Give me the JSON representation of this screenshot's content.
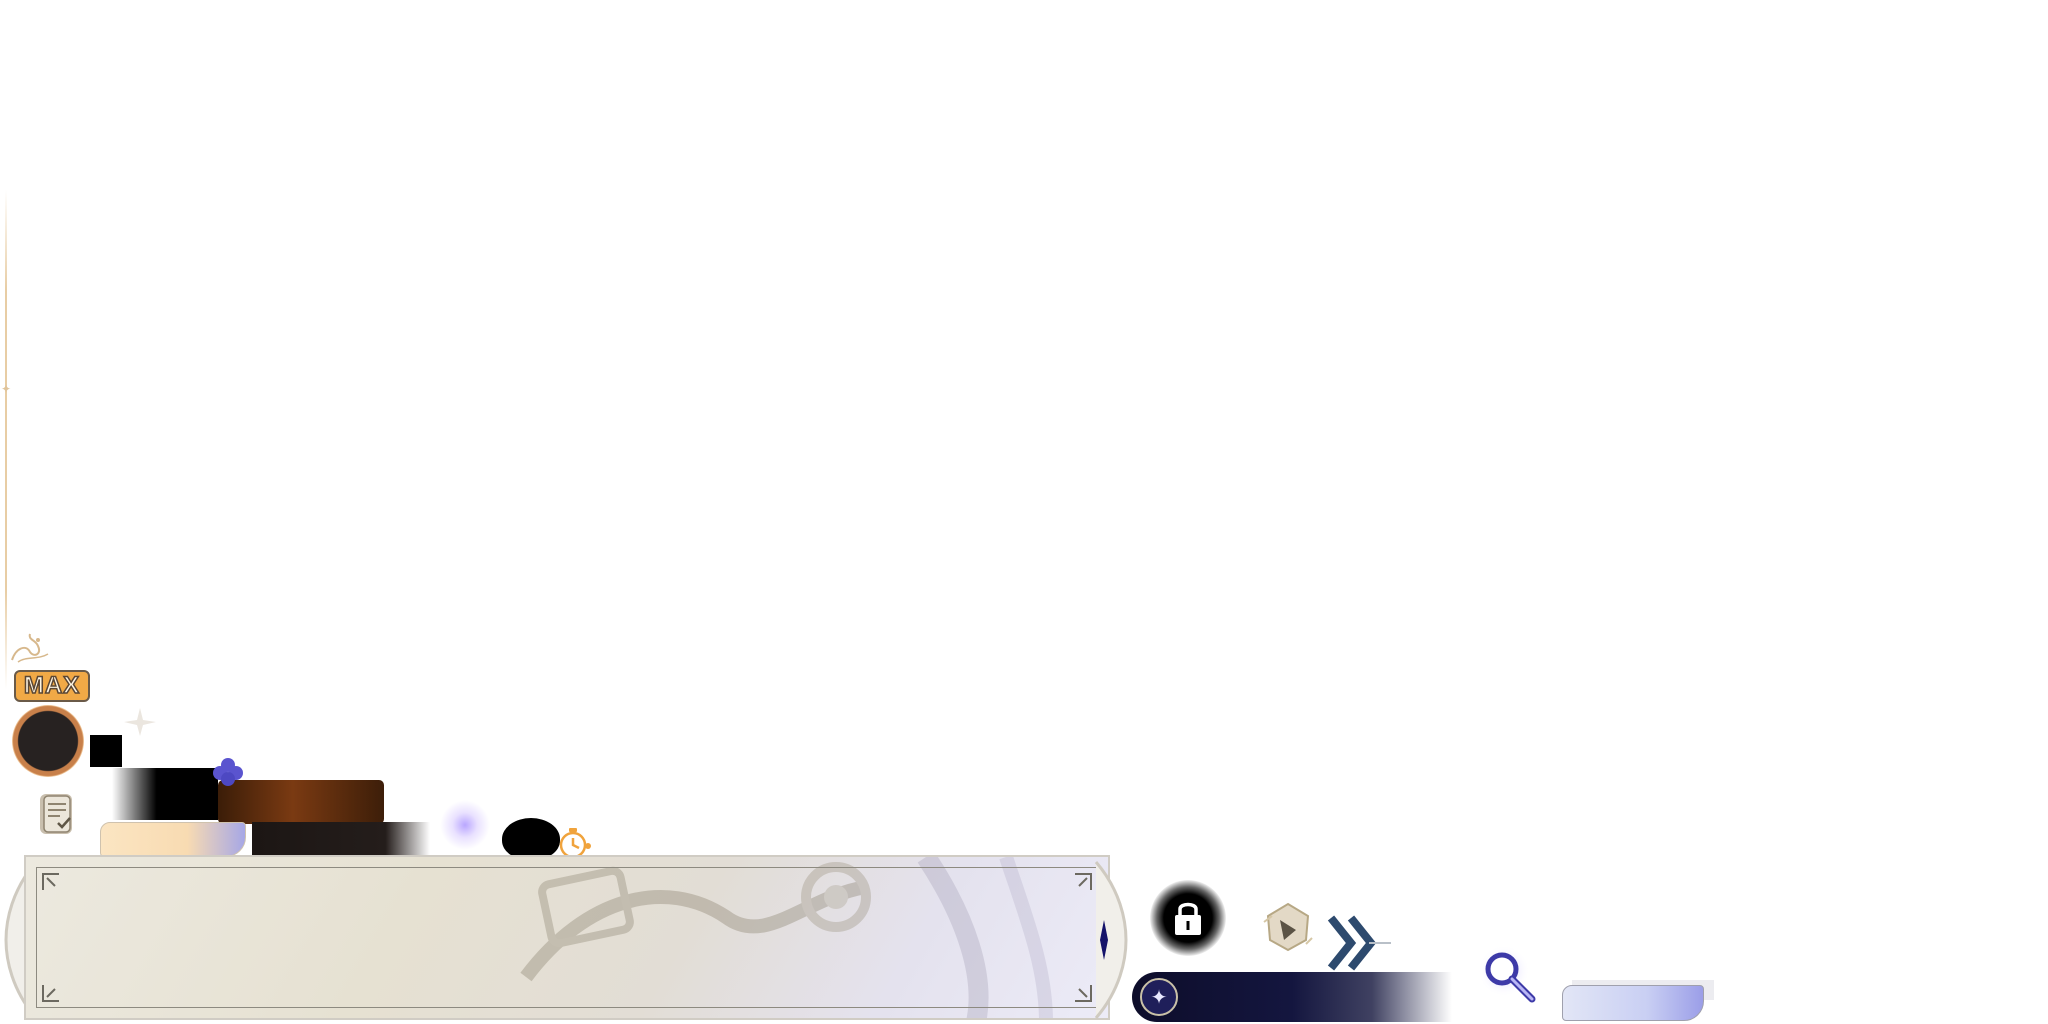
{
  "hud": {
    "max_badge_label": "MAX",
    "progress": 0.0
  },
  "icons": {
    "flourish": "ornament-flourish-icon",
    "avatar": "avatar-ring",
    "spark": "spark-icon",
    "clover": "blue-clover-icon",
    "scroll": "quest-scroll-icon",
    "timer": "timer-icon",
    "lock": "lock-icon",
    "auto": "auto-play-icon",
    "skip": "skip-icon",
    "search": "search-icon",
    "gem": "star-gem-icon"
  },
  "colors": {
    "max_badge": "#f1a946",
    "accent_gold": "#e8cda4",
    "accent_navy": "#14163f",
    "accent_purple": "#5a54cf",
    "skip_blue": "#2d4a6e"
  }
}
